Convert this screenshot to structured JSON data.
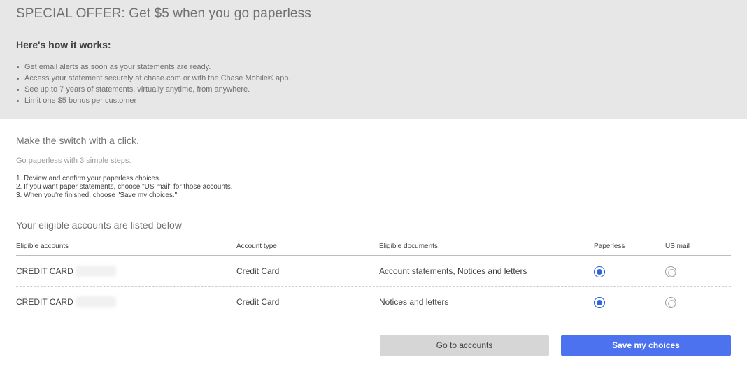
{
  "offer": {
    "title": "SPECIAL OFFER: Get $5 when you go paperless",
    "subtitle": "Here's how it works:",
    "bullets": [
      "Get email alerts as soon as your statements are ready.",
      "Access your statement securely at chase.com or with the Chase Mobile® app.",
      "See up to 7 years of statements, virtually anytime, from anywhere.",
      "Limit one $5 bonus per customer"
    ]
  },
  "instructions": {
    "title": "Make the switch with a click.",
    "intro": "Go paperless with 3 simple steps:",
    "steps": [
      "1. Review and confirm your paperless choices.",
      "2. If you want paper statements, choose \"US mail\" for those accounts.",
      "3. When you're finished, choose \"Save my choices.\""
    ]
  },
  "accounts": {
    "heading": "Your eligible accounts are listed below",
    "columns": [
      "Eligible accounts",
      "Account type",
      "Eligible documents",
      "Paperless",
      "US mail"
    ],
    "rows": [
      {
        "account": "CREDIT CARD",
        "type": "Credit Card",
        "documents": "Account statements, Notices and letters",
        "paperless": true,
        "us_mail": false
      },
      {
        "account": "CREDIT CARD",
        "type": "Credit Card",
        "documents": "Notices and letters",
        "paperless": true,
        "us_mail": false
      }
    ]
  },
  "actions": {
    "go_to_accounts": "Go to accounts",
    "save": "Save my choices"
  },
  "colors": {
    "offer_background": "#e7e7e8",
    "primary_button": "#4c72f0",
    "secondary_button": "#d6d6d7",
    "radio_selected": "#2f66e0"
  }
}
